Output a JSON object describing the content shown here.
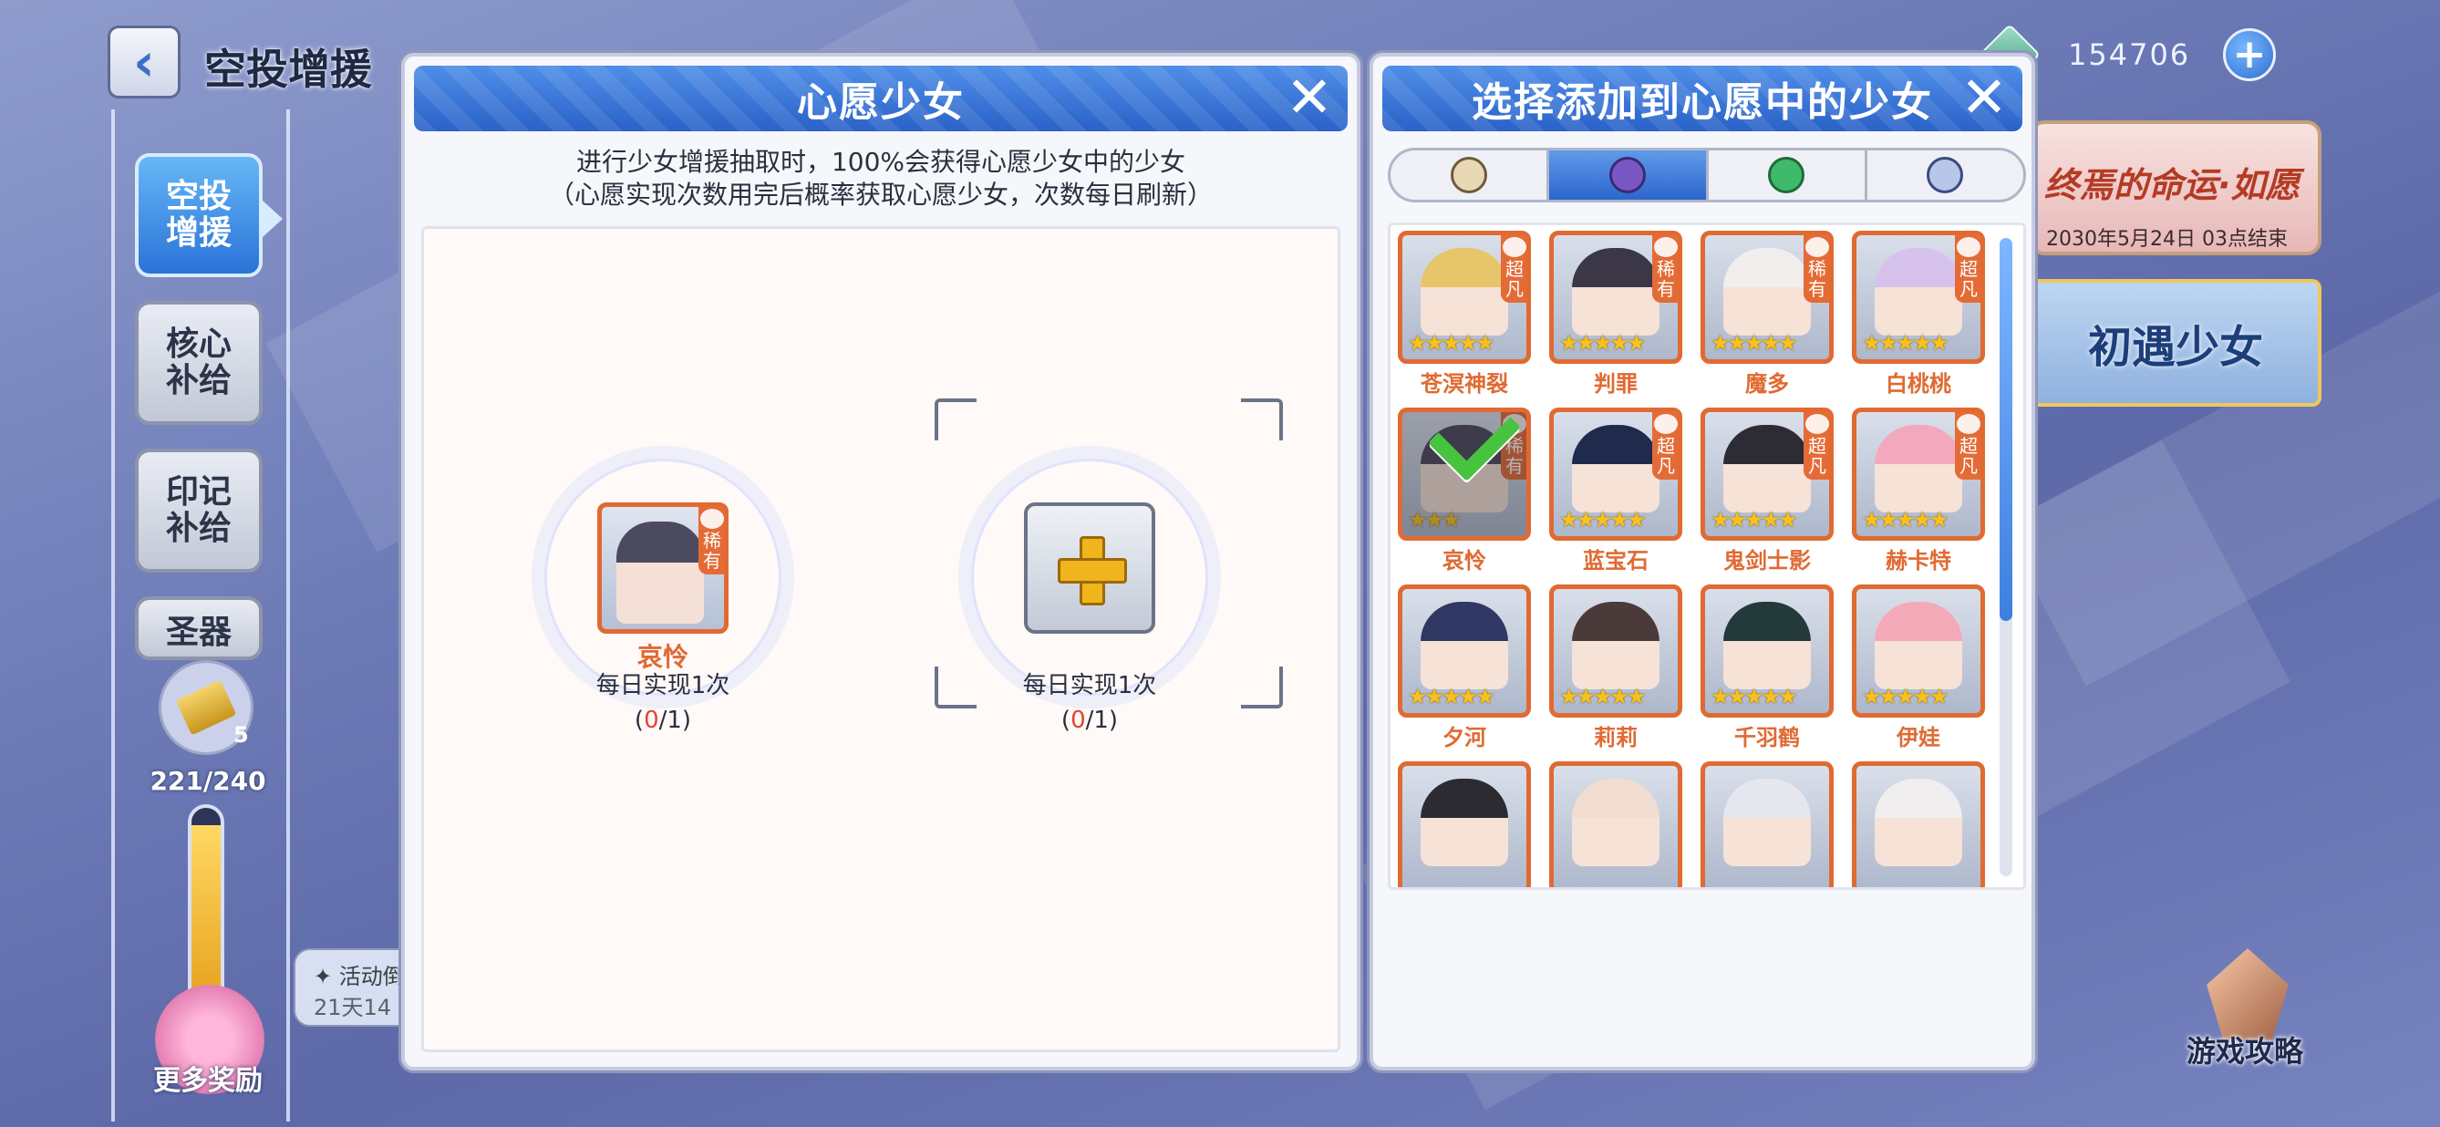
{
  "top": {
    "title": "空投增援",
    "currency_amount": "154706"
  },
  "sidebar": {
    "tabs": [
      {
        "label": "空投\n增援",
        "active": true
      },
      {
        "label": "核心\n补给",
        "active": false
      },
      {
        "label": "印记\n补给",
        "active": false
      },
      {
        "label": "圣器",
        "active": false
      }
    ],
    "ticket_count": "5",
    "progress_text": "221/240",
    "progress_fraction": 0.92,
    "reward_label": "更多奖励",
    "event_label": "✦ 活动倒",
    "event_sub": "21天14"
  },
  "banners": {
    "fate_title": "终焉的命运·如愿",
    "fate_date": "2030年5月24日 03点结束",
    "first_meet": "初遇少女"
  },
  "guide_label": "游戏攻略",
  "wish_panel": {
    "title": "心愿少女",
    "desc_line1": "进行少女增援抽取时，100%会获得心愿少女中的少女",
    "desc_line2": "（心愿实现次数用完后概率获取心愿少女，次数每日刷新）",
    "slots": [
      {
        "name": "哀怜",
        "rarity": "稀有",
        "info": "每日实现1次",
        "used": "0",
        "total": "/1"
      },
      {
        "name": "",
        "info": "每日实现1次",
        "used": "0",
        "total": "/1"
      }
    ]
  },
  "select_panel": {
    "title": "选择添加到心愿中的少女",
    "filter_icons": [
      "element-light-icon",
      "element-dark-icon",
      "element-wind-icon",
      "element-crystal-icon"
    ],
    "active_filter": 1,
    "characters": [
      {
        "name": "苍溟神裂",
        "rarity": "超凡",
        "stars": 5,
        "color": "#e7c56a"
      },
      {
        "name": "判罪",
        "rarity": "稀有",
        "stars": 5,
        "color": "#3b3747"
      },
      {
        "name": "魔多",
        "rarity": "稀有",
        "stars": 5,
        "color": "#f0efee"
      },
      {
        "name": "白桃桃",
        "rarity": "超凡",
        "stars": 5,
        "color": "#d7c2ee"
      },
      {
        "name": "哀怜",
        "rarity": "稀有",
        "stars": 3,
        "color": "#4a475a",
        "selected": true
      },
      {
        "name": "蓝宝石",
        "rarity": "超凡",
        "stars": 5,
        "color": "#1f2a4d"
      },
      {
        "name": "鬼剑士影",
        "rarity": "超凡",
        "stars": 5,
        "color": "#2d2b33"
      },
      {
        "name": "赫卡特",
        "rarity": "超凡",
        "stars": 5,
        "color": "#f3a9bd"
      },
      {
        "name": "夕河",
        "rarity": "",
        "stars": 5,
        "color": "#2f3762"
      },
      {
        "name": "莉莉",
        "rarity": "",
        "stars": 5,
        "color": "#4b3a3a"
      },
      {
        "name": "千羽鹤",
        "rarity": "",
        "stars": 5,
        "color": "#23393a"
      },
      {
        "name": "伊娃",
        "rarity": "",
        "stars": 5,
        "color": "#f4a9b9"
      },
      {
        "name": "",
        "rarity": "",
        "stars": 0,
        "color": "#2c2b31"
      },
      {
        "name": "",
        "rarity": "",
        "stars": 0,
        "color": "#f1ddd0"
      },
      {
        "name": "",
        "rarity": "",
        "stars": 0,
        "color": "#e6e6ef"
      },
      {
        "name": "",
        "rarity": "",
        "stars": 0,
        "color": "#f0eeee"
      }
    ]
  }
}
